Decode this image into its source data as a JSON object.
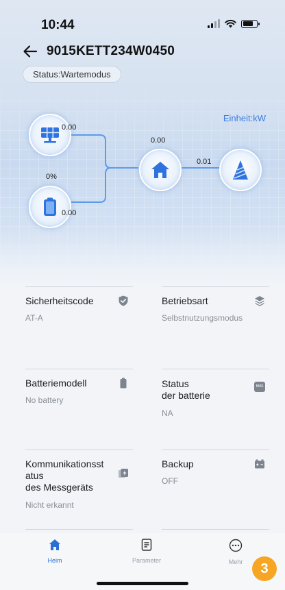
{
  "status_bar": {
    "time": "10:44"
  },
  "header": {
    "title": "9015KETT234W0450",
    "status": "Status:Wartemodus"
  },
  "diagram": {
    "unit": "Einheit:kW",
    "solar_power": "0.00",
    "battery_soc": "0%",
    "battery_power": "0.00",
    "home_power": "0.00",
    "grid_power": "0.01"
  },
  "cards": [
    {
      "label": "Sicherheitscode",
      "value": "AT-A",
      "icon": "shield-check-icon"
    },
    {
      "label": "Betriebsart",
      "value": "Selbstnutzungsmodus",
      "icon": "layers-icon"
    },
    {
      "label": "Batteriemodell",
      "value": "No battery",
      "icon": "battery-icon"
    },
    {
      "label": "Status\nder batterie",
      "value": "NA",
      "icon": "bms-icon",
      "icon_text": "BMS"
    },
    {
      "label": "Kommunikationsst\natus\ndes Messgeräts",
      "value": "Nicht erkannt",
      "icon": "meter-icon"
    },
    {
      "label": "Backup",
      "value": "OFF",
      "icon": "backup-battery-icon"
    }
  ],
  "tabs": [
    {
      "label": "Heim",
      "icon": "home-icon",
      "active": true
    },
    {
      "label": "Parameter",
      "icon": "document-icon",
      "active": false
    },
    {
      "label": "Mehr",
      "icon": "more-icon",
      "active": false
    }
  ],
  "badge": "3",
  "colors": {
    "accent": "#2a6fd8",
    "flow_line": "#5b9be8",
    "badge": "#f6a623"
  }
}
